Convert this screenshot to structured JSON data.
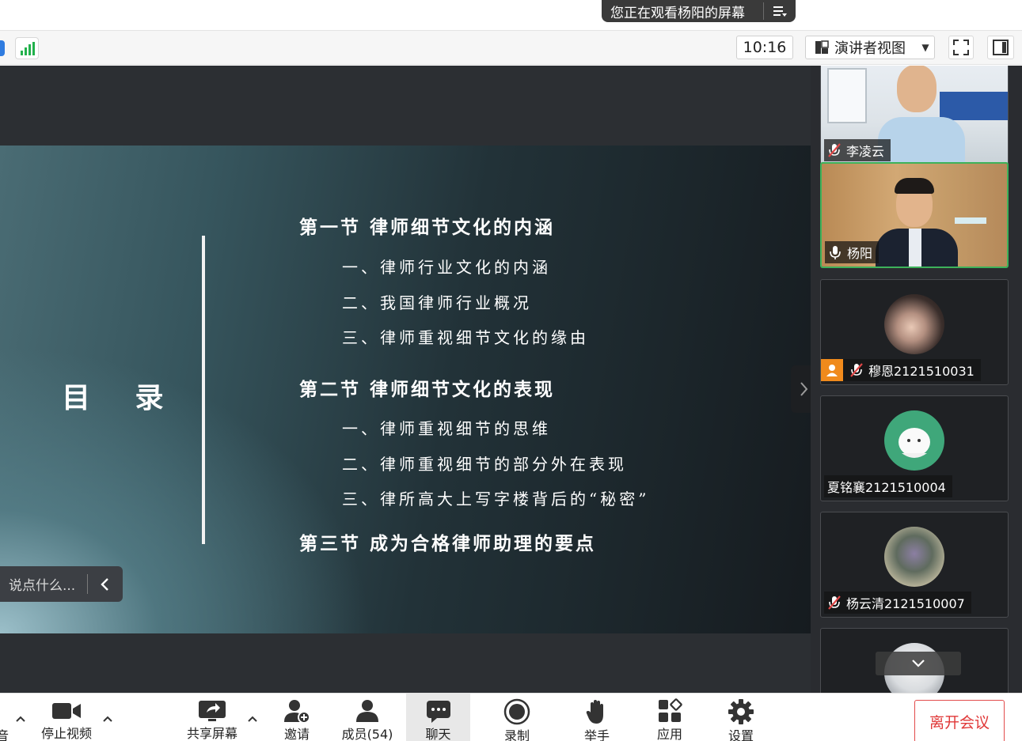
{
  "banner": {
    "text": "您正在观看杨阳的屏幕"
  },
  "toolbar": {
    "time": "10:16",
    "view_label": "演讲者视图"
  },
  "slide": {
    "title": "目 录",
    "sections": [
      {
        "heading": "第一节  律师细节文化的内涵",
        "items": [
          "一、律师行业文化的内涵",
          "二、我国律师行业概况",
          "三、律师重视细节文化的缘由"
        ]
      },
      {
        "heading": "第二节  律师细节文化的表现",
        "items": [
          "一、律师重视细节的思维",
          "二、律师重视细节的部分外在表现",
          "三、律所高大上写字楼背后的“秘密”"
        ]
      },
      {
        "heading": "第三节  成为合格律师助理的要点",
        "items": []
      }
    ]
  },
  "chat": {
    "placeholder": "说点什么..."
  },
  "participants": [
    {
      "name": "李凌云",
      "mic": "muted"
    },
    {
      "name": "杨阳",
      "mic": "on"
    },
    {
      "name": "穆恩2121510031",
      "mic": "muted"
    },
    {
      "name": "夏铭襄2121510004",
      "mic": "none"
    },
    {
      "name": "杨云清2121510007",
      "mic": "muted"
    }
  ],
  "bottombar": {
    "audio_partial": "音",
    "stop_video": "停止视频",
    "share_screen": "共享屏幕",
    "invite": "邀请",
    "members": "成员(54)",
    "chat": "聊天",
    "record": "录制",
    "raise_hand": "举手",
    "apps": "应用",
    "settings": "设置",
    "leave": "离开会议"
  },
  "colors": {
    "active_speaker": "#3db25a",
    "leave": "#e03838",
    "muted": "#e04646",
    "user_badge": "#f08a1c"
  }
}
